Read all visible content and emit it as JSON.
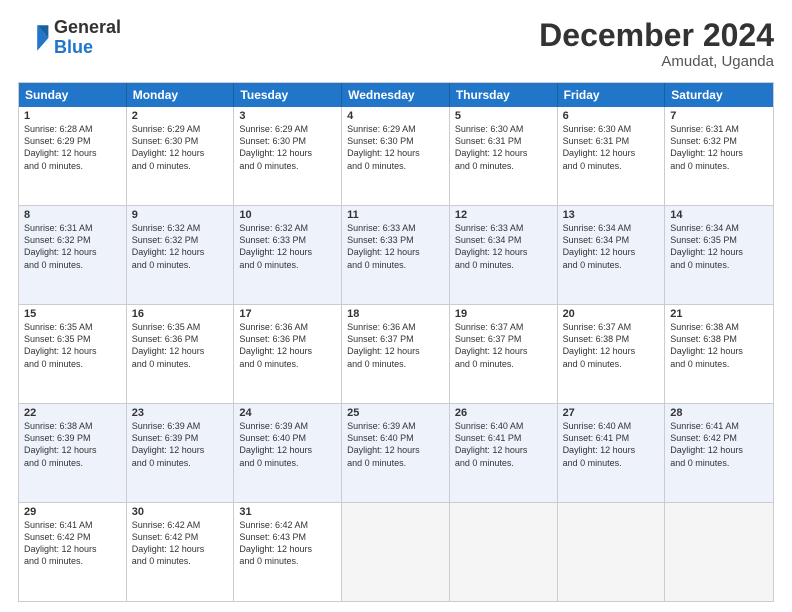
{
  "logo": {
    "text_general": "General",
    "text_blue": "Blue"
  },
  "title": "December 2024",
  "subtitle": "Amudat, Uganda",
  "header_days": [
    "Sunday",
    "Monday",
    "Tuesday",
    "Wednesday",
    "Thursday",
    "Friday",
    "Saturday"
  ],
  "weeks": [
    {
      "alt": false,
      "cells": [
        {
          "day": 1,
          "lines": [
            "Sunrise: 6:28 AM",
            "Sunset: 6:29 PM",
            "Daylight: 12 hours",
            "and 0 minutes."
          ]
        },
        {
          "day": 2,
          "lines": [
            "Sunrise: 6:29 AM",
            "Sunset: 6:30 PM",
            "Daylight: 12 hours",
            "and 0 minutes."
          ]
        },
        {
          "day": 3,
          "lines": [
            "Sunrise: 6:29 AM",
            "Sunset: 6:30 PM",
            "Daylight: 12 hours",
            "and 0 minutes."
          ]
        },
        {
          "day": 4,
          "lines": [
            "Sunrise: 6:29 AM",
            "Sunset: 6:30 PM",
            "Daylight: 12 hours",
            "and 0 minutes."
          ]
        },
        {
          "day": 5,
          "lines": [
            "Sunrise: 6:30 AM",
            "Sunset: 6:31 PM",
            "Daylight: 12 hours",
            "and 0 minutes."
          ]
        },
        {
          "day": 6,
          "lines": [
            "Sunrise: 6:30 AM",
            "Sunset: 6:31 PM",
            "Daylight: 12 hours",
            "and 0 minutes."
          ]
        },
        {
          "day": 7,
          "lines": [
            "Sunrise: 6:31 AM",
            "Sunset: 6:32 PM",
            "Daylight: 12 hours",
            "and 0 minutes."
          ]
        }
      ]
    },
    {
      "alt": true,
      "cells": [
        {
          "day": 8,
          "lines": [
            "Sunrise: 6:31 AM",
            "Sunset: 6:32 PM",
            "Daylight: 12 hours",
            "and 0 minutes."
          ]
        },
        {
          "day": 9,
          "lines": [
            "Sunrise: 6:32 AM",
            "Sunset: 6:32 PM",
            "Daylight: 12 hours",
            "and 0 minutes."
          ]
        },
        {
          "day": 10,
          "lines": [
            "Sunrise: 6:32 AM",
            "Sunset: 6:33 PM",
            "Daylight: 12 hours",
            "and 0 minutes."
          ]
        },
        {
          "day": 11,
          "lines": [
            "Sunrise: 6:33 AM",
            "Sunset: 6:33 PM",
            "Daylight: 12 hours",
            "and 0 minutes."
          ]
        },
        {
          "day": 12,
          "lines": [
            "Sunrise: 6:33 AM",
            "Sunset: 6:34 PM",
            "Daylight: 12 hours",
            "and 0 minutes."
          ]
        },
        {
          "day": 13,
          "lines": [
            "Sunrise: 6:34 AM",
            "Sunset: 6:34 PM",
            "Daylight: 12 hours",
            "and 0 minutes."
          ]
        },
        {
          "day": 14,
          "lines": [
            "Sunrise: 6:34 AM",
            "Sunset: 6:35 PM",
            "Daylight: 12 hours",
            "and 0 minutes."
          ]
        }
      ]
    },
    {
      "alt": false,
      "cells": [
        {
          "day": 15,
          "lines": [
            "Sunrise: 6:35 AM",
            "Sunset: 6:35 PM",
            "Daylight: 12 hours",
            "and 0 minutes."
          ]
        },
        {
          "day": 16,
          "lines": [
            "Sunrise: 6:35 AM",
            "Sunset: 6:36 PM",
            "Daylight: 12 hours",
            "and 0 minutes."
          ]
        },
        {
          "day": 17,
          "lines": [
            "Sunrise: 6:36 AM",
            "Sunset: 6:36 PM",
            "Daylight: 12 hours",
            "and 0 minutes."
          ]
        },
        {
          "day": 18,
          "lines": [
            "Sunrise: 6:36 AM",
            "Sunset: 6:37 PM",
            "Daylight: 12 hours",
            "and 0 minutes."
          ]
        },
        {
          "day": 19,
          "lines": [
            "Sunrise: 6:37 AM",
            "Sunset: 6:37 PM",
            "Daylight: 12 hours",
            "and 0 minutes."
          ]
        },
        {
          "day": 20,
          "lines": [
            "Sunrise: 6:37 AM",
            "Sunset: 6:38 PM",
            "Daylight: 12 hours",
            "and 0 minutes."
          ]
        },
        {
          "day": 21,
          "lines": [
            "Sunrise: 6:38 AM",
            "Sunset: 6:38 PM",
            "Daylight: 12 hours",
            "and 0 minutes."
          ]
        }
      ]
    },
    {
      "alt": true,
      "cells": [
        {
          "day": 22,
          "lines": [
            "Sunrise: 6:38 AM",
            "Sunset: 6:39 PM",
            "Daylight: 12 hours",
            "and 0 minutes."
          ]
        },
        {
          "day": 23,
          "lines": [
            "Sunrise: 6:39 AM",
            "Sunset: 6:39 PM",
            "Daylight: 12 hours",
            "and 0 minutes."
          ]
        },
        {
          "day": 24,
          "lines": [
            "Sunrise: 6:39 AM",
            "Sunset: 6:40 PM",
            "Daylight: 12 hours",
            "and 0 minutes."
          ]
        },
        {
          "day": 25,
          "lines": [
            "Sunrise: 6:39 AM",
            "Sunset: 6:40 PM",
            "Daylight: 12 hours",
            "and 0 minutes."
          ]
        },
        {
          "day": 26,
          "lines": [
            "Sunrise: 6:40 AM",
            "Sunset: 6:41 PM",
            "Daylight: 12 hours",
            "and 0 minutes."
          ]
        },
        {
          "day": 27,
          "lines": [
            "Sunrise: 6:40 AM",
            "Sunset: 6:41 PM",
            "Daylight: 12 hours",
            "and 0 minutes."
          ]
        },
        {
          "day": 28,
          "lines": [
            "Sunrise: 6:41 AM",
            "Sunset: 6:42 PM",
            "Daylight: 12 hours",
            "and 0 minutes."
          ]
        }
      ]
    },
    {
      "alt": false,
      "cells": [
        {
          "day": 29,
          "lines": [
            "Sunrise: 6:41 AM",
            "Sunset: 6:42 PM",
            "Daylight: 12 hours",
            "and 0 minutes."
          ]
        },
        {
          "day": 30,
          "lines": [
            "Sunrise: 6:42 AM",
            "Sunset: 6:42 PM",
            "Daylight: 12 hours",
            "and 0 minutes."
          ]
        },
        {
          "day": 31,
          "lines": [
            "Sunrise: 6:42 AM",
            "Sunset: 6:43 PM",
            "Daylight: 12 hours",
            "and 0 minutes."
          ]
        },
        {
          "day": null
        },
        {
          "day": null
        },
        {
          "day": null
        },
        {
          "day": null
        }
      ]
    }
  ]
}
